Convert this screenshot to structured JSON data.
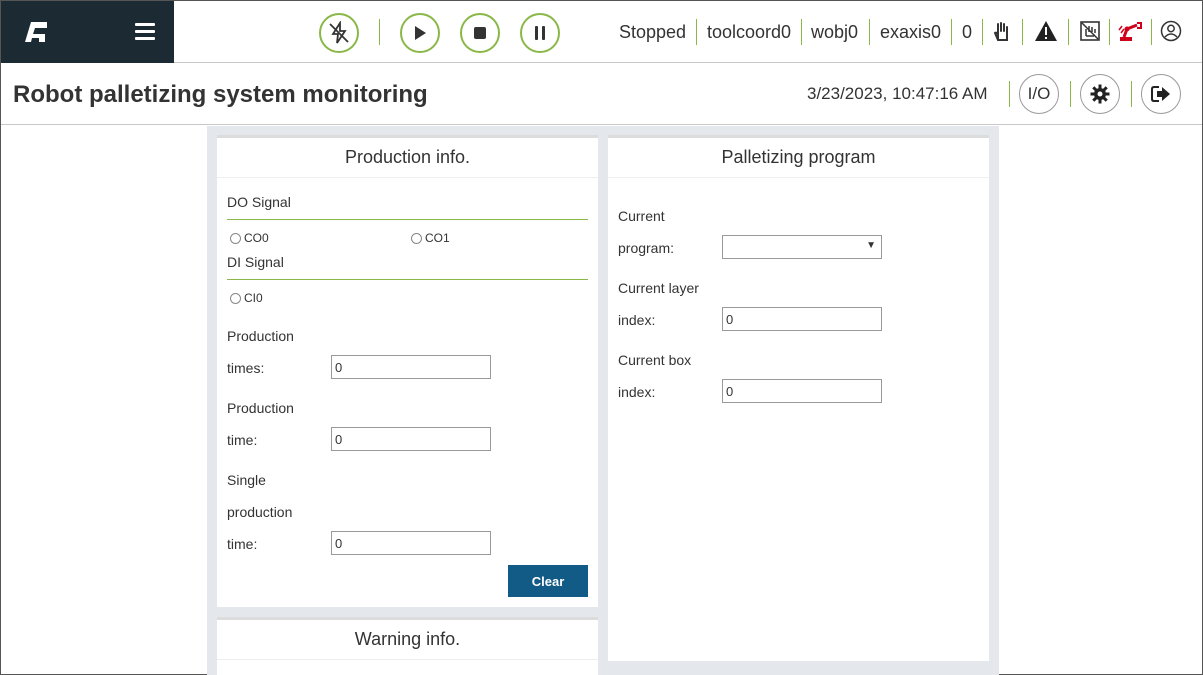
{
  "topbar": {
    "status": "Stopped",
    "tool": "toolcoord0",
    "wobj": "wobj0",
    "exaxis": "exaxis0",
    "count": "0",
    "icons": [
      "motor-off-icon",
      "play-icon",
      "stop-icon",
      "pause-icon",
      "hand-icon",
      "warning-icon",
      "emergency-stop-icon",
      "robot-arm-icon",
      "user-icon"
    ]
  },
  "titlebar": {
    "title": "Robot palletizing system monitoring",
    "datetime": "3/23/2023, 10:47:16 AM",
    "io_label": "I/O"
  },
  "production": {
    "title": "Production info.",
    "do_signal": "DO Signal",
    "do_options": [
      "CO0",
      "CO1"
    ],
    "di_signal": "DI Signal",
    "di_options": [
      "CI0"
    ],
    "times_label_1": "Production",
    "times_label_2": "times:",
    "times_value": "0",
    "time_label_1": "Production",
    "time_label_2": "time:",
    "time_value": "0",
    "single_label_1": "Single",
    "single_label_2": "production",
    "single_label_3": "time:",
    "single_value": "0",
    "clear_label": "Clear"
  },
  "palletizing": {
    "title": "Palletizing program",
    "program_label_1": "Current",
    "program_label_2": "program:",
    "program_value": "",
    "layer_label_1": "Current layer",
    "layer_label_2": "index:",
    "layer_value": "0",
    "box_label_1": "Current box",
    "box_label_2": "index:",
    "box_value": "0"
  },
  "warning": {
    "title": "Warning info."
  },
  "colors": {
    "brand_bg": "#1c2a33",
    "accent_green": "#8ab848",
    "button_blue": "#135b87",
    "alert_red": "#d0021b"
  }
}
